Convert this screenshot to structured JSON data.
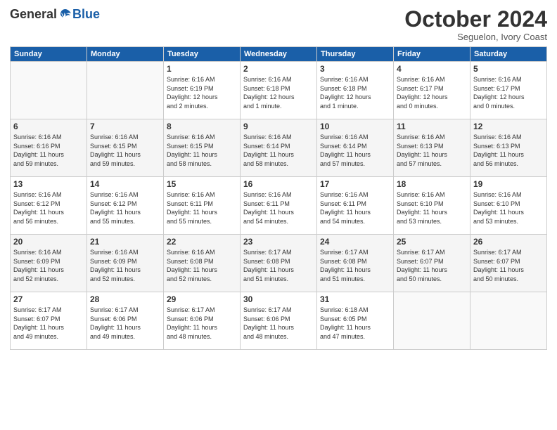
{
  "header": {
    "logo": {
      "general": "General",
      "blue": "Blue"
    },
    "title": "October 2024",
    "subtitle": "Seguelon, Ivory Coast"
  },
  "days_of_week": [
    "Sunday",
    "Monday",
    "Tuesday",
    "Wednesday",
    "Thursday",
    "Friday",
    "Saturday"
  ],
  "weeks": [
    [
      {
        "day": "",
        "info": ""
      },
      {
        "day": "",
        "info": ""
      },
      {
        "day": "1",
        "info": "Sunrise: 6:16 AM\nSunset: 6:19 PM\nDaylight: 12 hours\nand 2 minutes."
      },
      {
        "day": "2",
        "info": "Sunrise: 6:16 AM\nSunset: 6:18 PM\nDaylight: 12 hours\nand 1 minute."
      },
      {
        "day": "3",
        "info": "Sunrise: 6:16 AM\nSunset: 6:18 PM\nDaylight: 12 hours\nand 1 minute."
      },
      {
        "day": "4",
        "info": "Sunrise: 6:16 AM\nSunset: 6:17 PM\nDaylight: 12 hours\nand 0 minutes."
      },
      {
        "day": "5",
        "info": "Sunrise: 6:16 AM\nSunset: 6:17 PM\nDaylight: 12 hours\nand 0 minutes."
      }
    ],
    [
      {
        "day": "6",
        "info": "Sunrise: 6:16 AM\nSunset: 6:16 PM\nDaylight: 11 hours\nand 59 minutes."
      },
      {
        "day": "7",
        "info": "Sunrise: 6:16 AM\nSunset: 6:15 PM\nDaylight: 11 hours\nand 59 minutes."
      },
      {
        "day": "8",
        "info": "Sunrise: 6:16 AM\nSunset: 6:15 PM\nDaylight: 11 hours\nand 58 minutes."
      },
      {
        "day": "9",
        "info": "Sunrise: 6:16 AM\nSunset: 6:14 PM\nDaylight: 11 hours\nand 58 minutes."
      },
      {
        "day": "10",
        "info": "Sunrise: 6:16 AM\nSunset: 6:14 PM\nDaylight: 11 hours\nand 57 minutes."
      },
      {
        "day": "11",
        "info": "Sunrise: 6:16 AM\nSunset: 6:13 PM\nDaylight: 11 hours\nand 57 minutes."
      },
      {
        "day": "12",
        "info": "Sunrise: 6:16 AM\nSunset: 6:13 PM\nDaylight: 11 hours\nand 56 minutes."
      }
    ],
    [
      {
        "day": "13",
        "info": "Sunrise: 6:16 AM\nSunset: 6:12 PM\nDaylight: 11 hours\nand 56 minutes."
      },
      {
        "day": "14",
        "info": "Sunrise: 6:16 AM\nSunset: 6:12 PM\nDaylight: 11 hours\nand 55 minutes."
      },
      {
        "day": "15",
        "info": "Sunrise: 6:16 AM\nSunset: 6:11 PM\nDaylight: 11 hours\nand 55 minutes."
      },
      {
        "day": "16",
        "info": "Sunrise: 6:16 AM\nSunset: 6:11 PM\nDaylight: 11 hours\nand 54 minutes."
      },
      {
        "day": "17",
        "info": "Sunrise: 6:16 AM\nSunset: 6:11 PM\nDaylight: 11 hours\nand 54 minutes."
      },
      {
        "day": "18",
        "info": "Sunrise: 6:16 AM\nSunset: 6:10 PM\nDaylight: 11 hours\nand 53 minutes."
      },
      {
        "day": "19",
        "info": "Sunrise: 6:16 AM\nSunset: 6:10 PM\nDaylight: 11 hours\nand 53 minutes."
      }
    ],
    [
      {
        "day": "20",
        "info": "Sunrise: 6:16 AM\nSunset: 6:09 PM\nDaylight: 11 hours\nand 52 minutes."
      },
      {
        "day": "21",
        "info": "Sunrise: 6:16 AM\nSunset: 6:09 PM\nDaylight: 11 hours\nand 52 minutes."
      },
      {
        "day": "22",
        "info": "Sunrise: 6:16 AM\nSunset: 6:08 PM\nDaylight: 11 hours\nand 52 minutes."
      },
      {
        "day": "23",
        "info": "Sunrise: 6:17 AM\nSunset: 6:08 PM\nDaylight: 11 hours\nand 51 minutes."
      },
      {
        "day": "24",
        "info": "Sunrise: 6:17 AM\nSunset: 6:08 PM\nDaylight: 11 hours\nand 51 minutes."
      },
      {
        "day": "25",
        "info": "Sunrise: 6:17 AM\nSunset: 6:07 PM\nDaylight: 11 hours\nand 50 minutes."
      },
      {
        "day": "26",
        "info": "Sunrise: 6:17 AM\nSunset: 6:07 PM\nDaylight: 11 hours\nand 50 minutes."
      }
    ],
    [
      {
        "day": "27",
        "info": "Sunrise: 6:17 AM\nSunset: 6:07 PM\nDaylight: 11 hours\nand 49 minutes."
      },
      {
        "day": "28",
        "info": "Sunrise: 6:17 AM\nSunset: 6:06 PM\nDaylight: 11 hours\nand 49 minutes."
      },
      {
        "day": "29",
        "info": "Sunrise: 6:17 AM\nSunset: 6:06 PM\nDaylight: 11 hours\nand 48 minutes."
      },
      {
        "day": "30",
        "info": "Sunrise: 6:17 AM\nSunset: 6:06 PM\nDaylight: 11 hours\nand 48 minutes."
      },
      {
        "day": "31",
        "info": "Sunrise: 6:18 AM\nSunset: 6:05 PM\nDaylight: 11 hours\nand 47 minutes."
      },
      {
        "day": "",
        "info": ""
      },
      {
        "day": "",
        "info": ""
      }
    ]
  ]
}
